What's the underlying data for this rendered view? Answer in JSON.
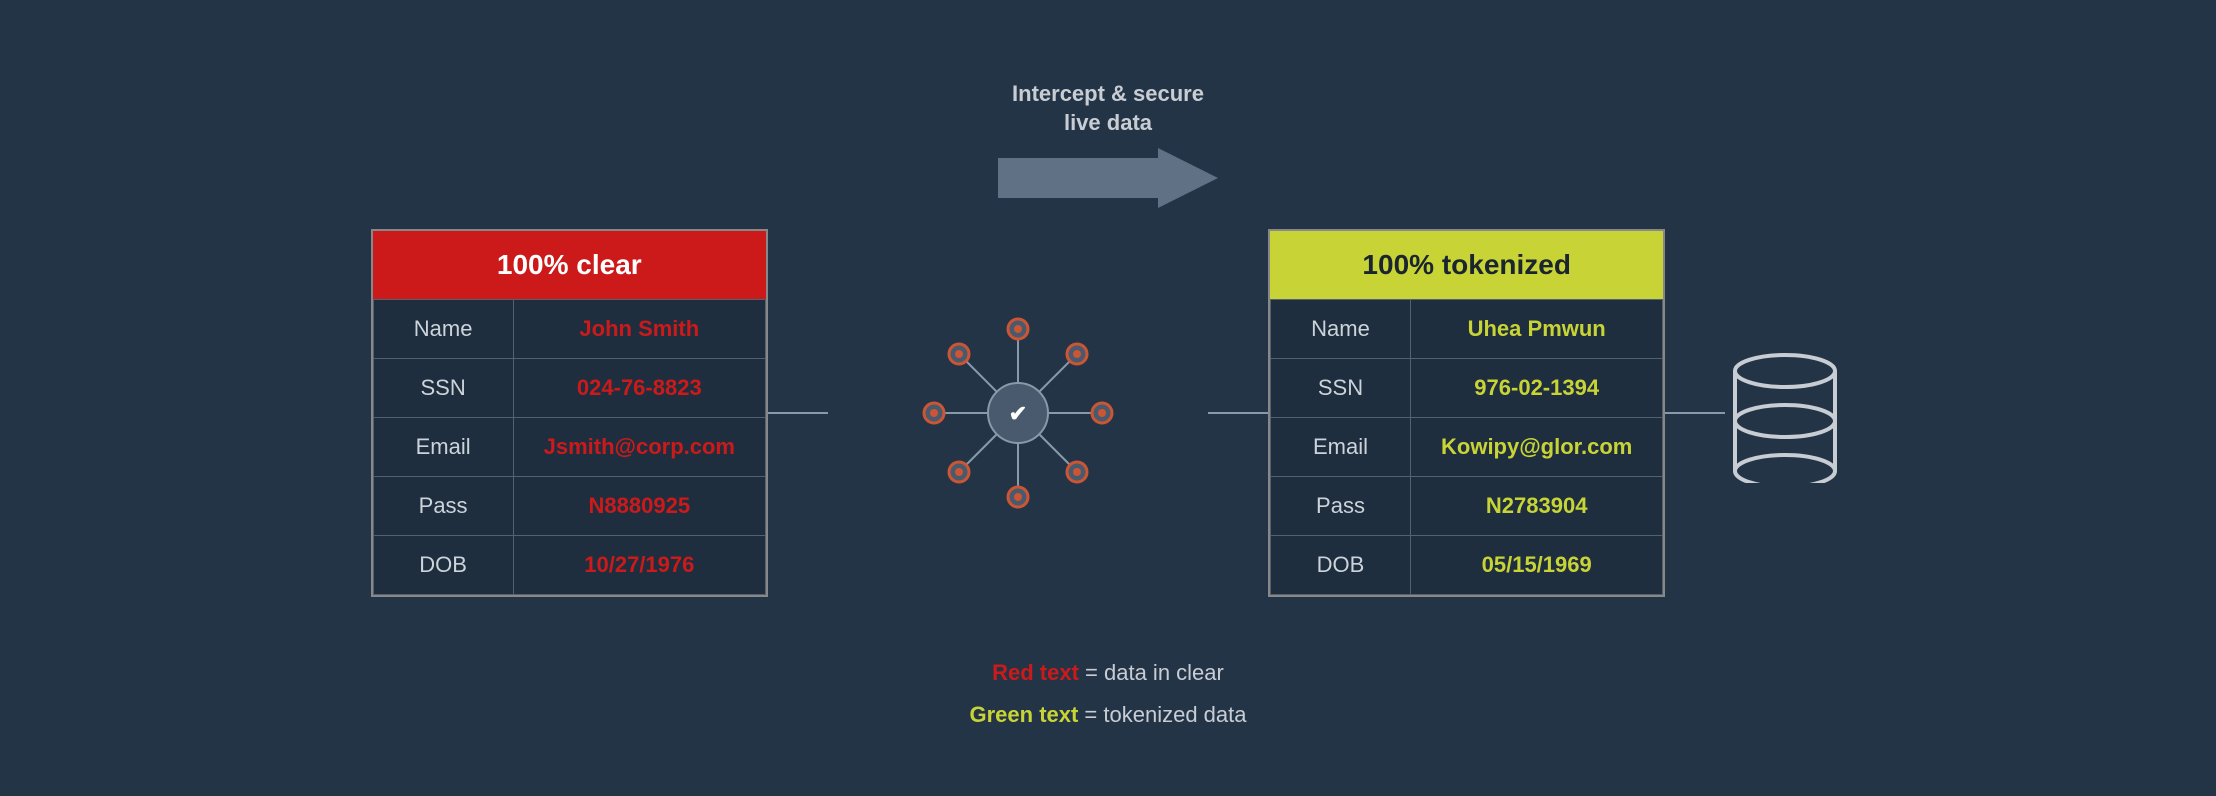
{
  "arrow": {
    "label_line1": "Intercept & secure",
    "label_line2": "live data"
  },
  "left_table": {
    "header": "100% clear",
    "rows": [
      {
        "field": "Name",
        "value": "John Smith"
      },
      {
        "field": "SSN",
        "value": "024-76-8823"
      },
      {
        "field": "Email",
        "value": "Jsmith@corp.com"
      },
      {
        "field": "Pass",
        "value": "N8880925"
      },
      {
        "field": "DOB",
        "value": "10/27/1976"
      }
    ]
  },
  "right_table": {
    "header": "100% tokenized",
    "rows": [
      {
        "field": "Name",
        "value": "Uhea Pmwun"
      },
      {
        "field": "SSN",
        "value": "976-02-1394"
      },
      {
        "field": "Email",
        "value": "Kowipy@glor.com"
      },
      {
        "field": "Pass",
        "value": "N2783904"
      },
      {
        "field": "DOB",
        "value": "05/15/1969"
      }
    ]
  },
  "legend": {
    "red_word": "Red text",
    "red_suffix": " = data in clear",
    "green_word": "Green text",
    "green_suffix": " = tokenized data"
  }
}
